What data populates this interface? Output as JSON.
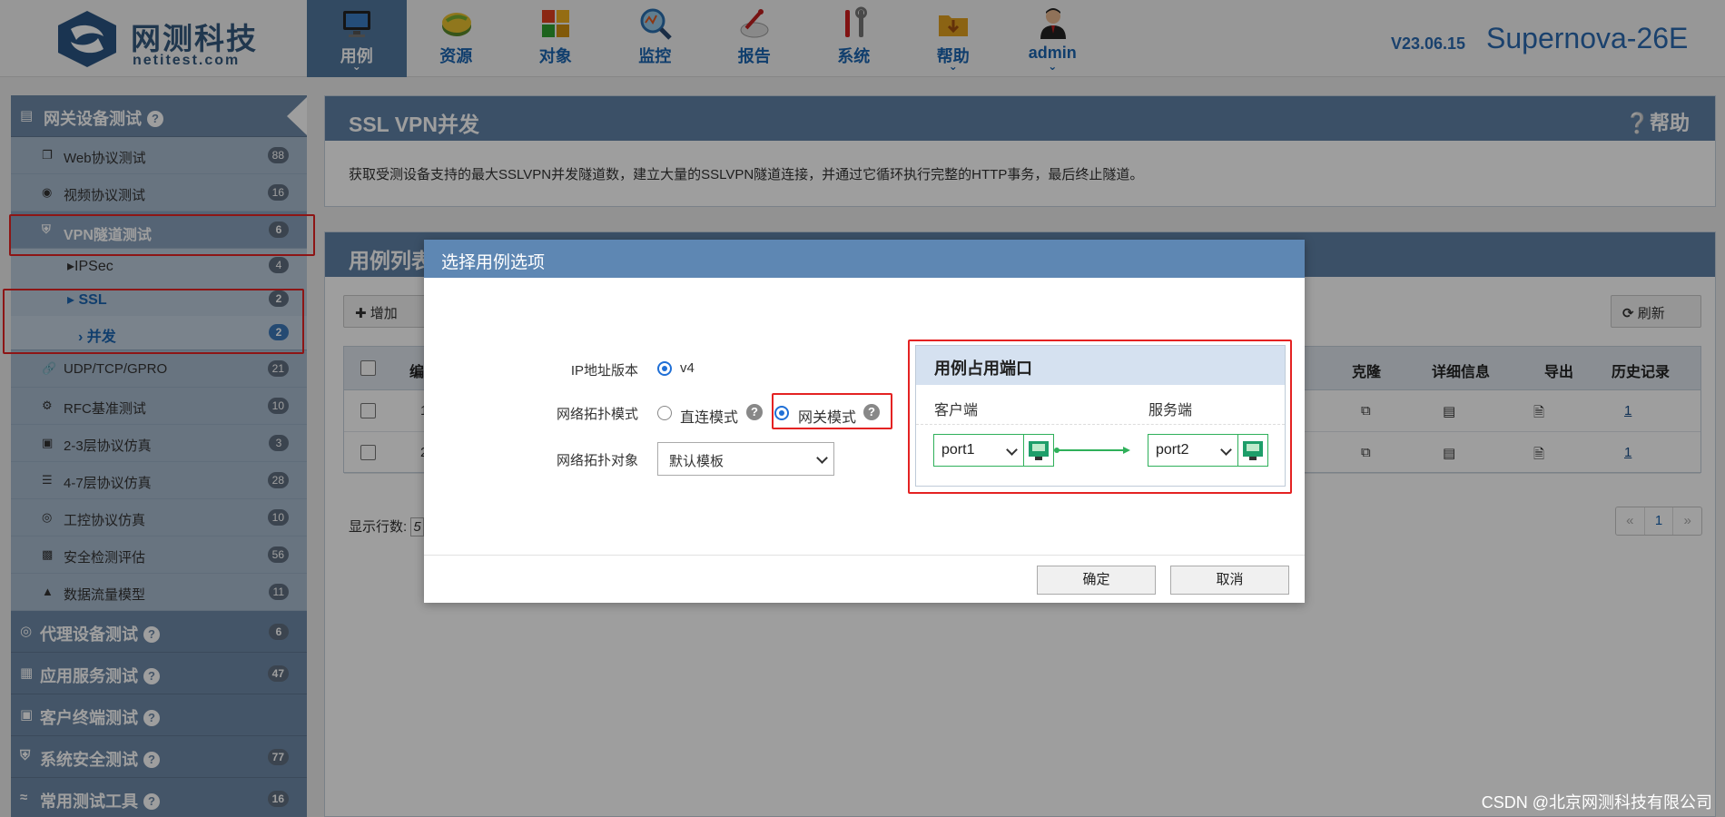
{
  "brand": {
    "name_cn": "网测科技",
    "name_en": "netitest.com"
  },
  "top_nav": [
    {
      "label": "用例",
      "icon": "monitor-icon",
      "active": true,
      "has_dropdown": true
    },
    {
      "label": "资源",
      "icon": "disk-icon",
      "active": false,
      "has_dropdown": false
    },
    {
      "label": "对象",
      "icon": "blocks-icon",
      "active": false,
      "has_dropdown": false
    },
    {
      "label": "监控",
      "icon": "magnifier-icon",
      "active": false,
      "has_dropdown": false
    },
    {
      "label": "报告",
      "icon": "report-icon",
      "active": false,
      "has_dropdown": false
    },
    {
      "label": "系统",
      "icon": "tools-icon",
      "active": false,
      "has_dropdown": false
    },
    {
      "label": "帮助",
      "icon": "folder-icon",
      "active": false,
      "has_dropdown": true
    },
    {
      "label": "admin",
      "icon": "user-icon",
      "active": false,
      "has_dropdown": true
    }
  ],
  "version": "V23.06.15",
  "product": "Supernova-26E",
  "sidebar": {
    "group1": {
      "label": "网关设备测试",
      "icon": "device-icon"
    },
    "items": [
      {
        "label": "Web协议测试",
        "count": "88",
        "icon": "web-icon"
      },
      {
        "label": "视频协议测试",
        "count": "16",
        "icon": "play-icon"
      },
      {
        "label": "VPN隧道测试",
        "count": "6",
        "icon": "shield-icon"
      }
    ],
    "sub_ipsec": {
      "label": "IPSec",
      "count": "4"
    },
    "sub_ssl": {
      "label": "SSL",
      "count": "2"
    },
    "sub_concurrent": {
      "label": "并发",
      "count": "2"
    },
    "items2": [
      {
        "label": "UDP/TCP/GPRO",
        "count": "21",
        "icon": "link-icon"
      },
      {
        "label": "RFC基准测试",
        "count": "10",
        "icon": "gear-icon"
      },
      {
        "label": "2-3层协议仿真",
        "count": "3",
        "icon": "hdd-icon"
      },
      {
        "label": "4-7层协议仿真",
        "count": "28",
        "icon": "server-icon"
      },
      {
        "label": "工控协议仿真",
        "count": "10",
        "icon": "target-icon"
      },
      {
        "label": "安全检测评估",
        "count": "56",
        "icon": "bars-icon"
      },
      {
        "label": "数据流量模型",
        "count": "11",
        "icon": "flask-icon"
      }
    ],
    "groups": [
      {
        "label": "代理设备测试",
        "count": "6",
        "icon": "proxy-icon"
      },
      {
        "label": "应用服务测试",
        "count": "47",
        "icon": "building-icon"
      },
      {
        "label": "客户终端测试",
        "count": "",
        "icon": "terminal-icon"
      },
      {
        "label": "系统安全测试",
        "count": "77",
        "icon": "shield-icon"
      },
      {
        "label": "常用测试工具",
        "count": "16",
        "icon": "wifi-icon"
      }
    ]
  },
  "page": {
    "title": "SSL VPN并发",
    "help": "帮助",
    "description": "获取受测设备支持的最大SSLVPN并发隧道数，建立大量的SSLVPN隧道连接，并通过它循环执行完整的HTTP事务，最后终止隧道。"
  },
  "list": {
    "title": "用例列表",
    "add_label": "增加",
    "refresh_label": "刷新",
    "columns": [
      "编",
      "克隆",
      "详细信息",
      "导出",
      "历史记录"
    ],
    "rows": [
      {
        "no": "1",
        "history": "1"
      },
      {
        "no": "2",
        "history": "1"
      }
    ],
    "rows_per_page_label": "显示行数:",
    "rows_per_page_value": "5",
    "pager": {
      "prev": "«",
      "page": "1",
      "next": "»"
    }
  },
  "dialog": {
    "title": "选择用例选项",
    "ip_version_label": "IP地址版本",
    "ip_version_value": "v4",
    "topo_mode_label": "网络拓扑模式",
    "topo_mode_direct": "直连模式",
    "topo_mode_gateway": "网关模式",
    "topo_mode_selected": "网关模式",
    "topo_object_label": "网络拓扑对象",
    "topo_object_value": "默认模板",
    "port_panel_title": "用例占用端口",
    "client_label": "客户端",
    "server_label": "服务端",
    "client_port": "port1",
    "server_port": "port2",
    "ok_label": "确定",
    "cancel_label": "取消"
  },
  "watermark": "CSDN @北京网测科技有限公司",
  "colors": {
    "accent": "#5e87b3",
    "highlight_red": "#e42222",
    "port_green": "#2fb05a"
  }
}
